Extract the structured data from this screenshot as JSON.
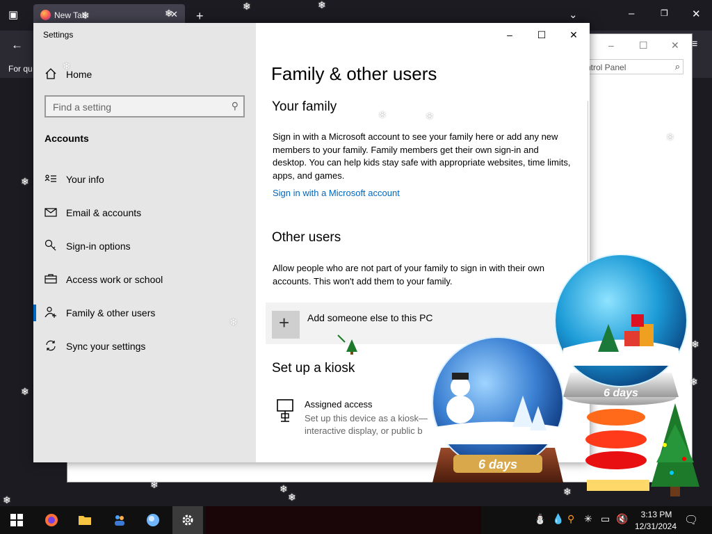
{
  "browser": {
    "tab_label": "New Tab",
    "truncated_text": "For qu"
  },
  "control_panel": {
    "search_placeholder": "ntrol Panel"
  },
  "settings": {
    "window_title": "Settings",
    "home_label": "Home",
    "search_placeholder": "Find a setting",
    "section_heading": "Accounts",
    "nav_items": [
      {
        "label": "Your info",
        "icon": "person-card-icon"
      },
      {
        "label": "Email & accounts",
        "icon": "envelope-icon"
      },
      {
        "label": "Sign-in options",
        "icon": "key-icon"
      },
      {
        "label": "Access work or school",
        "icon": "briefcase-icon"
      },
      {
        "label": "Family & other users",
        "icon": "person-add-icon",
        "active": true
      },
      {
        "label": "Sync your settings",
        "icon": "sync-icon"
      }
    ],
    "accent_color": "#0067c0"
  },
  "content": {
    "page_title": "Family & other users",
    "family_heading": "Your family",
    "family_text": "Sign in with a Microsoft account to see your family here or add any new members to your family. Family members get their own sign-in and desktop. You can help kids stay safe with appropriate websites, time limits, apps, and games.",
    "family_link": "Sign in with a Microsoft account",
    "other_heading": "Other users",
    "other_text": "Allow people who are not part of your family to sign in with their own accounts. This won't add them to your family.",
    "add_label": "Add someone else to this PC",
    "kiosk_heading": "Set up a kiosk",
    "kiosk_title": "Assigned access",
    "kiosk_desc": "Set up this device as a kiosk— interactive display, or public b"
  },
  "decorations": {
    "globe_label": "6 days"
  },
  "taskbar": {
    "time": "3:13 PM",
    "date": "12/31/2024"
  }
}
